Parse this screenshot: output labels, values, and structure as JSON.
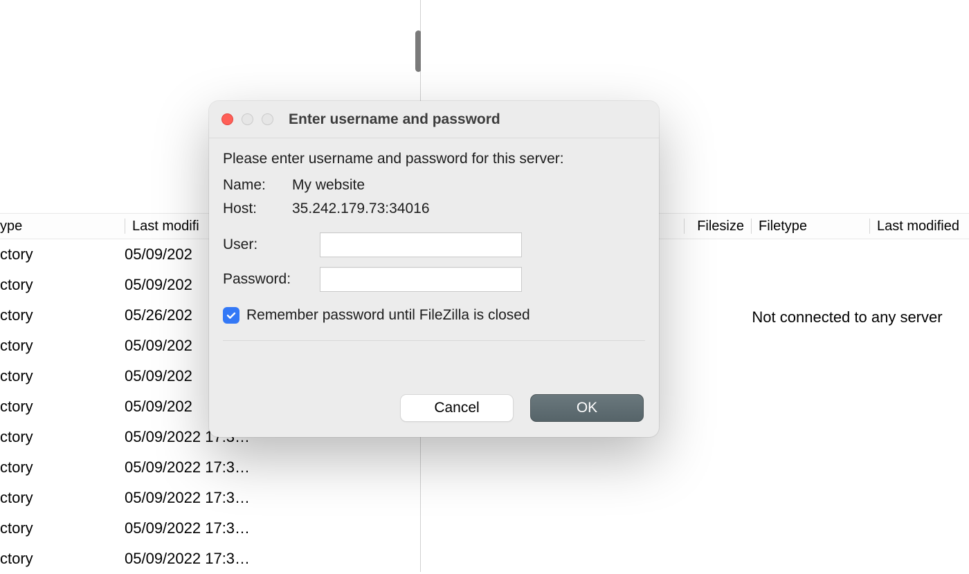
{
  "left_pane": {
    "columns": {
      "type": "ype",
      "modified": "Last modifi"
    },
    "rows": [
      {
        "type": "ctory",
        "modified": "05/09/202"
      },
      {
        "type": "ctory",
        "modified": "05/09/202"
      },
      {
        "type": "ctory",
        "modified": "05/26/202"
      },
      {
        "type": "ctory",
        "modified": "05/09/202"
      },
      {
        "type": "ctory",
        "modified": "05/09/202"
      },
      {
        "type": "ctory",
        "modified": "05/09/202"
      },
      {
        "type": "ctory",
        "modified": "05/09/2022 17:3…"
      },
      {
        "type": "ctory",
        "modified": "05/09/2022 17:3…"
      },
      {
        "type": "ctory",
        "modified": "05/09/2022 17:3…"
      },
      {
        "type": "ctory",
        "modified": "05/09/2022 17:3…"
      },
      {
        "type": "ctory",
        "modified": "05/09/2022 17:3…"
      }
    ]
  },
  "right_pane": {
    "columns": {
      "size": "Filesize",
      "type": "Filetype",
      "modified": "Last modified"
    },
    "empty_message": "Not connected to any server"
  },
  "dialog": {
    "title": "Enter username and password",
    "prompt": "Please enter username and password for this server:",
    "name_label": "Name:",
    "name_value": "My website",
    "host_label": "Host:",
    "host_value": "35.242.179.73:34016",
    "user_label": "User:",
    "user_value": "",
    "password_label": "Password:",
    "password_value": "",
    "remember_label": "Remember password until FileZilla is closed",
    "remember_checked": true,
    "cancel_label": "Cancel",
    "ok_label": "OK"
  }
}
